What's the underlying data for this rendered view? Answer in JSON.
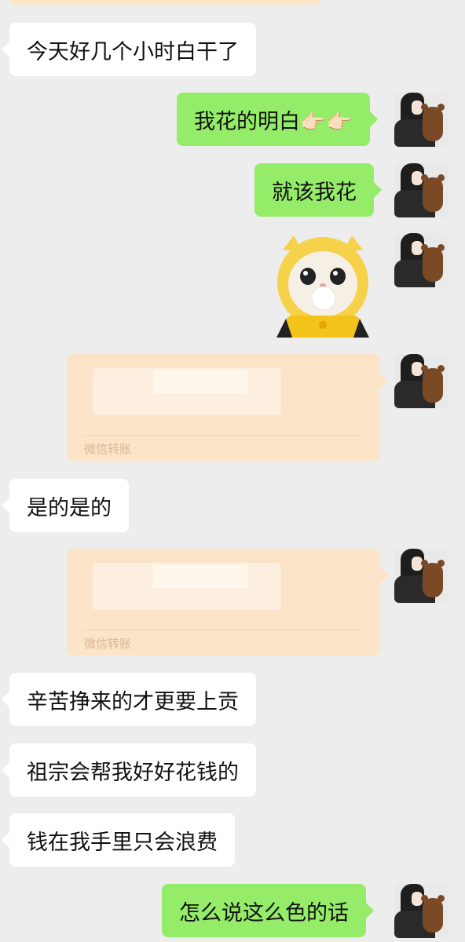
{
  "messages": [
    {
      "side": "left",
      "type": "text",
      "text": "今天好几个小时白干了"
    },
    {
      "side": "right",
      "type": "text",
      "text": "我花的明白👉🏻👉🏻"
    },
    {
      "side": "right",
      "type": "text",
      "text": "就该我花"
    },
    {
      "side": "right",
      "type": "sticker",
      "icon": "cat-sticker"
    },
    {
      "side": "right",
      "type": "transfer",
      "label": "微信转账"
    },
    {
      "side": "left",
      "type": "text",
      "text": "是的是的"
    },
    {
      "side": "right",
      "type": "transfer",
      "label": "微信转账"
    },
    {
      "side": "left",
      "type": "text",
      "text": "辛苦挣来的才更要上贡"
    },
    {
      "side": "left",
      "type": "text",
      "text": "祖宗会帮我好好花钱的"
    },
    {
      "side": "left",
      "type": "text",
      "text": "钱在我手里只会浪费"
    },
    {
      "side": "right",
      "type": "text",
      "text": "怎么说这么色的话"
    }
  ],
  "colors": {
    "background": "#ededed",
    "bubble_left": "#ffffff",
    "bubble_right": "#95ec69",
    "transfer": "#fbe4c7"
  }
}
